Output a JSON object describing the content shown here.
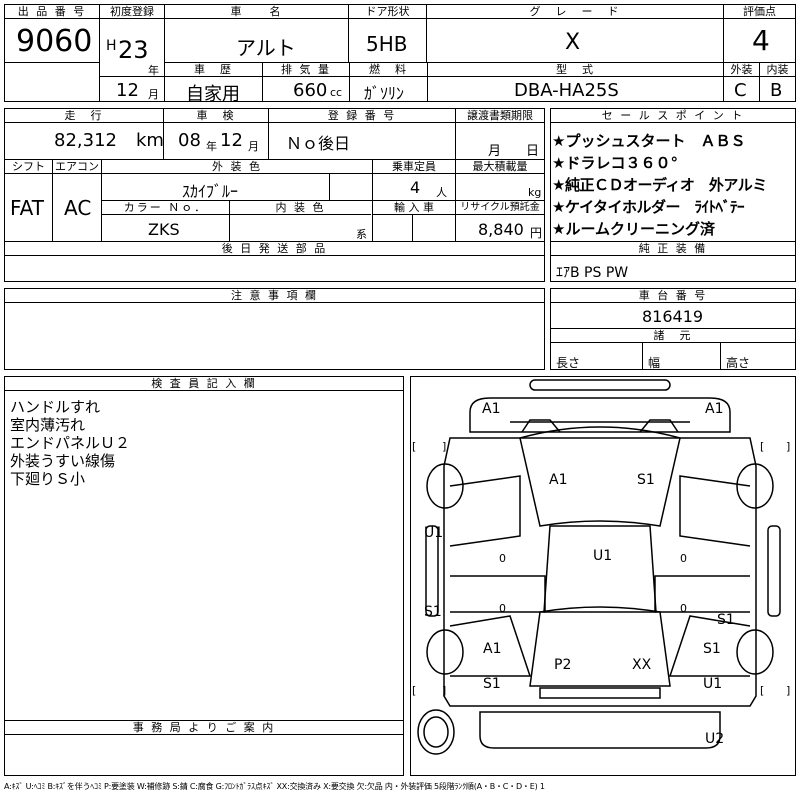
{
  "row1": {
    "lot_label": "出 品 番 号",
    "lot_no": "9060",
    "first_reg_label": "初度登録",
    "era": "H",
    "year": "23",
    "year_unit": "年",
    "month": "12",
    "month_unit": "月",
    "car_name_label": "車　　名",
    "car_name": "アルト",
    "door_label": "ドア形状",
    "door": "5HB",
    "grade_label": "グ　レ　ー　ド",
    "grade": "X",
    "score_label": "評価点",
    "score": "4",
    "history_label": "車　歴",
    "history": "自家用",
    "disp_label": "排 気 量",
    "disp": "660",
    "disp_unit": "cc",
    "fuel_label": "燃　料",
    "fuel": "ｶﾞｿﾘﾝ",
    "model_label": "型　式",
    "model": "DBA-HA25S",
    "ext_label": "外装",
    "ext": "C",
    "int_label": "内装",
    "int": "B"
  },
  "row2": {
    "mileage_label": "走　行",
    "mileage": "82,312",
    "mileage_unit": "km",
    "inspection_label": "車　検",
    "insp_year": "08",
    "insp_year_unit": "年",
    "insp_month": "12",
    "insp_month_unit": "月",
    "regno_label": "登 録 番 号",
    "regno": "Ｎｏ後日",
    "transfer_label": "譲渡書類期限",
    "transfer_month": "月",
    "transfer_day": "日",
    "shift_label": "シフト",
    "shift": "FAT",
    "ac_label": "エアコン",
    "ac": "AC",
    "exterior_label": "外 装 色",
    "exterior": "ｽｶｲﾌﾞﾙｰ",
    "capacity_label": "乗車定員",
    "capacity": "4",
    "capacity_unit": "人",
    "load_label": "最大積載量",
    "load_unit": "kg",
    "color_no_label": "カラー Ｎｏ．",
    "color_no": "ZKS",
    "interior_label": "内 装 色",
    "interior_unit": "系",
    "import_label": "輸 入 車",
    "recycle_label": "リサイクル預託金",
    "recycle": "8,840",
    "recycle_unit": "円",
    "later_label": "後 日 発 送 部 品"
  },
  "sales": {
    "label": "セ ー ル ス ポ イ ン ト",
    "points": [
      "★プッシュスタート　ＡＢＳ",
      "★ドラレコ３６０°",
      "★純正ＣＤオーディオ　外アルミ",
      "★ケイタイホルダー　ﾗｲﾄﾍﾞﾃｰ",
      "★ルームクリーニング済"
    ],
    "equip_label": "純 正 装 備",
    "equip": "ｴｱB PS PW"
  },
  "notes": {
    "label": "注 意 事 項 欄",
    "chassis_label": "車 台 番 号",
    "chassis": "816419",
    "dims_label": "諸　元",
    "len_label": "長さ",
    "width_label": "幅",
    "height_label": "高さ"
  },
  "inspector": {
    "label": "検 査 員 記 入 欄",
    "lines": [
      "ハンドルすれ",
      "室内薄汚れ",
      "エンドパネルＵ２",
      "外装うすい線傷",
      "下廻りＳ小"
    ],
    "office_label": "事 務 局 よ り ご 案 内"
  },
  "diagram": {
    "marks": {
      "a1_tl": "A1",
      "a1_tr": "A1",
      "a1_hood": "A1",
      "s1_hood": "S1",
      "u1_left": "U1",
      "u1_roof": "U1",
      "s1_left": "S1",
      "s1_right": "S1",
      "a1_lr": "A1",
      "s1_rr": "S1",
      "p2": "P2",
      "xx": "XX",
      "s1_ll": "S1",
      "u1_lr": "U1",
      "u2": "U2"
    },
    "brackets": [
      "[",
      "]",
      "[",
      "]",
      "[",
      "]",
      "[",
      "]"
    ],
    "zero": "0"
  },
  "legend": "A:ｷｽﾞ U:ﾍｺﾐ B:ｷｽﾞを伴うﾍｺﾐ P:要塗装 W:補修跡 S:錆 C:腐食 G:ﾌﾛﾝﾄｶﾞﾗｽ点ｷｽﾞ XX:交換済み X:要交換 欠:欠品 内・外装評価 5段階ﾗﾝｸ順(A・B・C・D・E) 1"
}
